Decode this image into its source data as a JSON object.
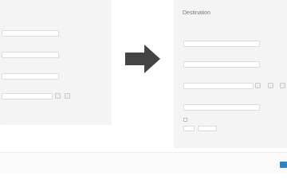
{
  "source": {
    "title": "",
    "fields": [
      {
        "label": "",
        "value": ""
      },
      {
        "label": "",
        "value": ""
      },
      {
        "label": "",
        "value": ""
      },
      {
        "label": "",
        "value": ""
      }
    ],
    "note": ""
  },
  "destination": {
    "title": "Destination",
    "link": "",
    "fields": [
      {
        "label": "",
        "value": ""
      },
      {
        "label": "",
        "value": ""
      },
      {
        "label": "",
        "value": ""
      },
      {
        "label": "",
        "value": ""
      }
    ],
    "checkbox_label": "",
    "number_value": "",
    "unit_value": ""
  },
  "colors": {
    "panel": "#f4f4f4",
    "accent": "#4a90d9",
    "primary_button": "#2a84c6",
    "arrow": "#444444"
  },
  "icons": {
    "arrow": "arrow-right-icon"
  }
}
